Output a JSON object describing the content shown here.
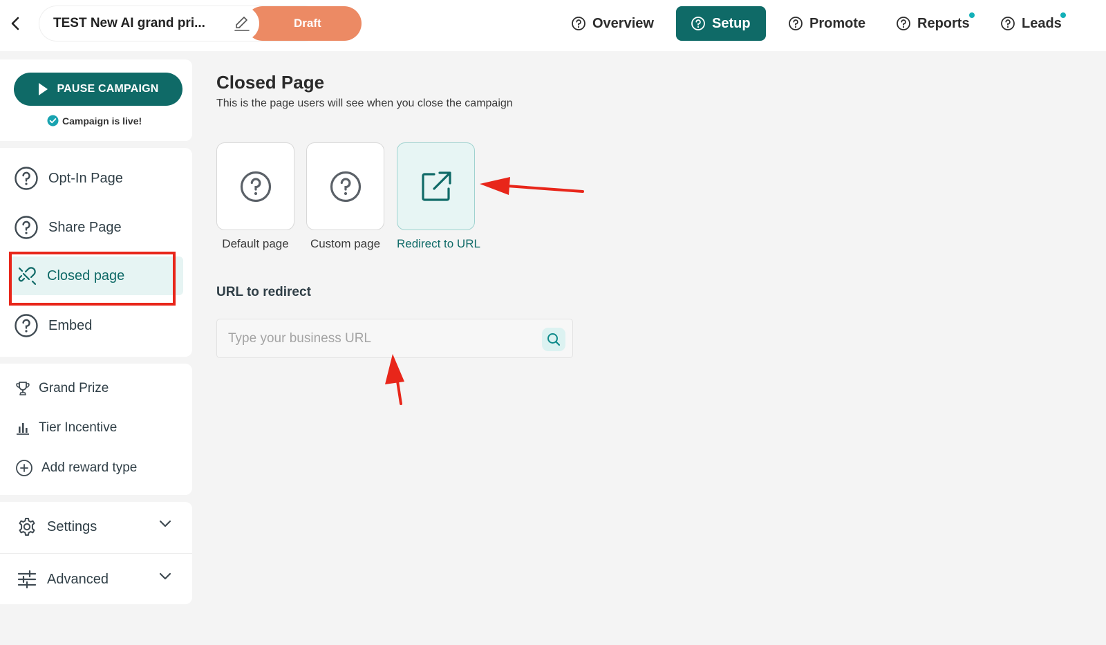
{
  "header": {
    "campaign_name": "TEST New AI grand pri...",
    "status": "Draft",
    "nav": [
      {
        "label": "Overview"
      },
      {
        "label": "Setup"
      },
      {
        "label": "Promote"
      },
      {
        "label": "Reports"
      },
      {
        "label": "Leads"
      }
    ],
    "active_tab": "Setup"
  },
  "sidebar": {
    "pause_label": "PAUSE CAMPAIGN",
    "live_status": "Campaign is live!",
    "pages": [
      {
        "label": "Opt-In Page",
        "icon": "question-circle-icon"
      },
      {
        "label": "Share Page",
        "icon": "question-circle-icon"
      },
      {
        "label": "Closed page",
        "icon": "unplug-icon"
      },
      {
        "label": "Embed",
        "icon": "question-circle-icon"
      }
    ],
    "rewards": [
      {
        "label": "Grand Prize",
        "icon": "trophy-icon"
      },
      {
        "label": "Tier Incentive",
        "icon": "bar-chart-icon"
      },
      {
        "label": "Add reward type",
        "icon": "plus-circle-icon"
      }
    ],
    "settings_label": "Settings",
    "advanced_label": "Advanced"
  },
  "main": {
    "title": "Closed Page",
    "subtitle": "This is the page users will see when you close the campaign",
    "options": [
      {
        "label": "Default page",
        "icon": "question-circle-icon"
      },
      {
        "label": "Custom page",
        "icon": "question-circle-icon"
      },
      {
        "label": "Redirect to URL",
        "icon": "external-link-icon"
      }
    ],
    "selected_option": "Redirect to URL",
    "url_label": "URL to redirect",
    "url_placeholder": "Type your business URL",
    "url_value": ""
  },
  "colors": {
    "brand": "#0f6a67",
    "draft": "#ec8a64",
    "selected_bg": "#e7f5f4",
    "annotation": "#e8261a"
  }
}
